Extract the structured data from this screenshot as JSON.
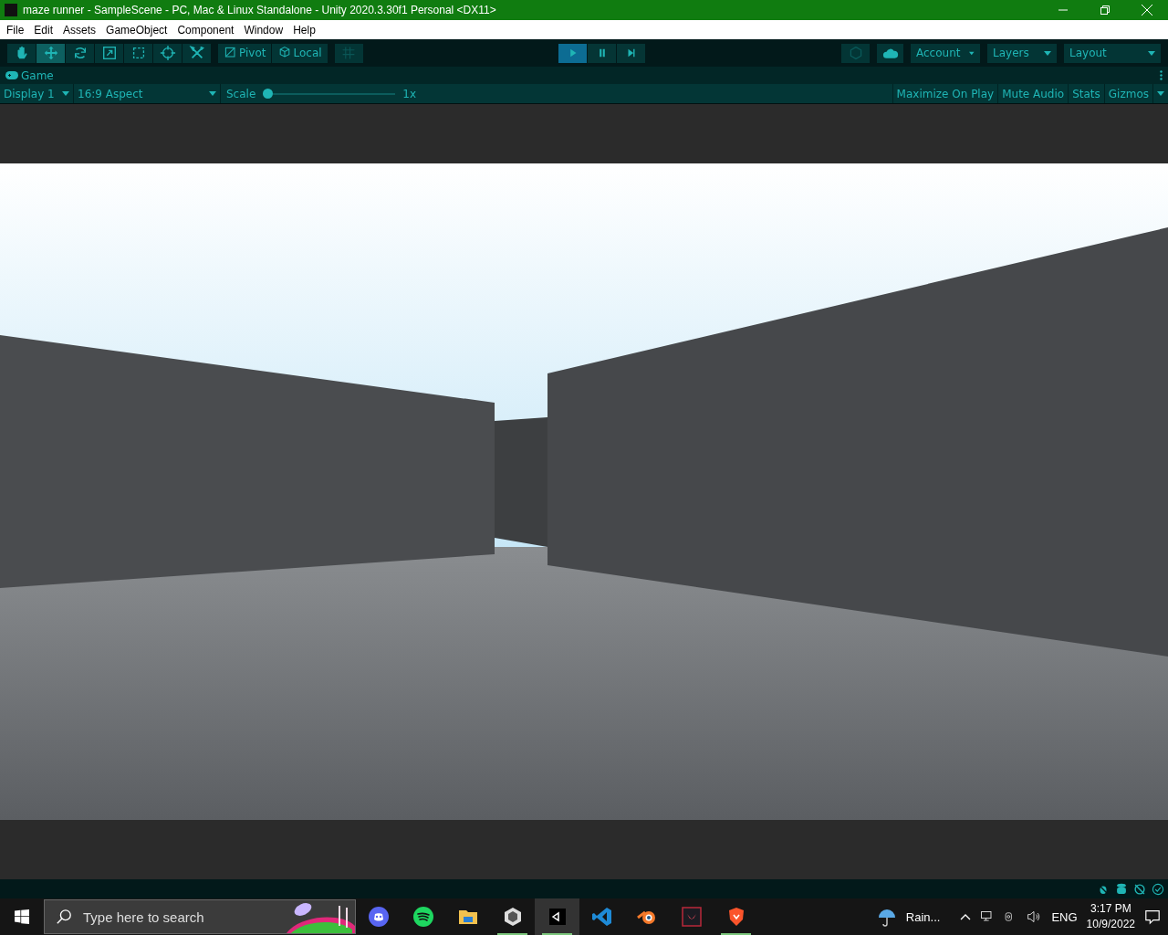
{
  "window": {
    "title": "maze runner - SampleScene - PC, Mac & Linux Standalone - Unity 2020.3.30f1 Personal <DX11>"
  },
  "menu": [
    "File",
    "Edit",
    "Assets",
    "GameObject",
    "Component",
    "Window",
    "Help"
  ],
  "tools": [
    {
      "selected": false
    },
    {
      "selected": true
    },
    {
      "selected": false
    },
    {
      "selected": false
    },
    {
      "selected": false
    },
    {
      "selected": false
    },
    {
      "selected": false
    }
  ],
  "handles": [
    "Pivot",
    "Local"
  ],
  "play_controls": [
    {
      "selected": true
    },
    {
      "selected": false
    },
    {
      "selected": false
    }
  ],
  "dropdowns": [
    "Account",
    "Layers",
    "Layout"
  ],
  "game_tab": {
    "label": "Game"
  },
  "game_toolbar": {
    "display": "Display 1",
    "aspect": "16:9 Aspect",
    "scale_label": "Scale",
    "scale": {
      "level": 0.0
    },
    "scale_reading": "1x",
    "toggles": [
      "Maximize On Play",
      "Mute Audio",
      "Stats",
      "Gizmos"
    ]
  },
  "taskbar": {
    "search": {
      "placeholder": "Type here to search"
    },
    "apps": [
      {
        "running": false,
        "selected": false
      },
      {
        "running": false,
        "selected": false
      },
      {
        "running": false,
        "selected": false
      },
      {
        "running": true,
        "selected": false
      },
      {
        "running": true,
        "selected": true
      },
      {
        "running": false,
        "selected": false
      },
      {
        "running": false,
        "selected": false
      },
      {
        "running": false,
        "selected": false
      },
      {
        "running": true,
        "selected": false
      }
    ],
    "weather": "Rain...",
    "language": "ENG",
    "time": "3:17 PM",
    "date": "10/9/2022"
  }
}
